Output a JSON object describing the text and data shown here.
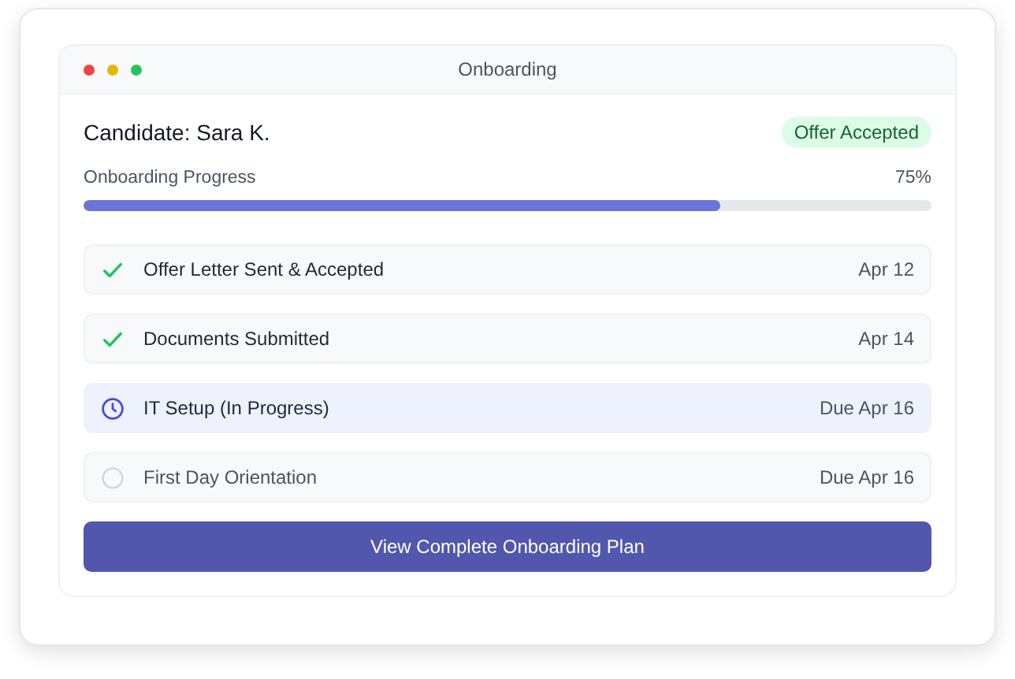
{
  "window": {
    "title": "Onboarding"
  },
  "candidate": {
    "name": "Candidate: Sara K.",
    "badge": "Offer Accepted"
  },
  "progress": {
    "label": "Onboarding Progress",
    "reading": "75%",
    "level": 0.75
  },
  "tasks": [
    {
      "kind": "done",
      "label": "Offer Letter Sent & Accepted",
      "date": "Apr 12"
    },
    {
      "kind": "done",
      "label": "Documents Submitted",
      "date": "Apr 14"
    },
    {
      "kind": "active",
      "label": "IT Setup (In Progress)",
      "date": "Due Apr 16"
    },
    {
      "kind": "pending",
      "label": "First Day Orientation",
      "date": "Due Apr 16"
    }
  ],
  "button": "View Complete Onboarding Plan"
}
